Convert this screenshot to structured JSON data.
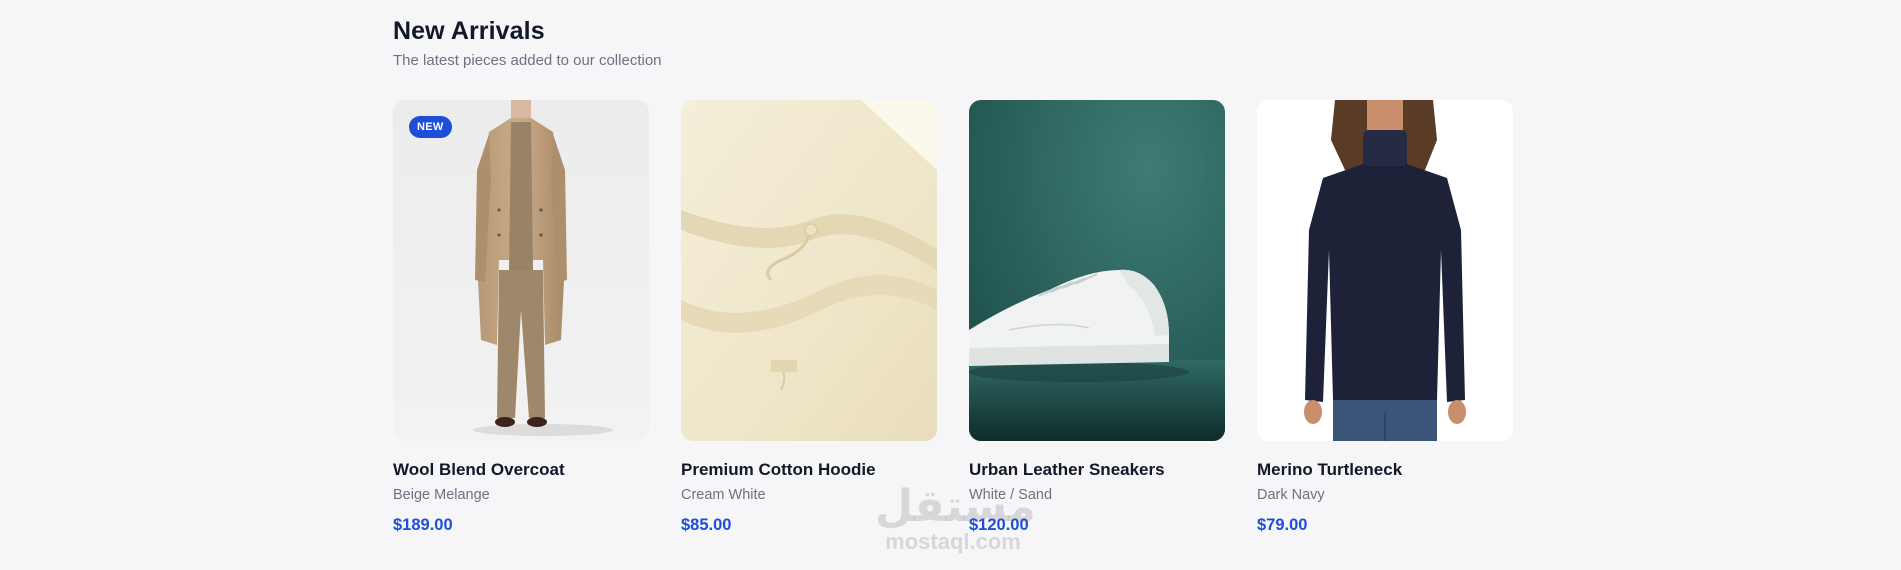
{
  "section": {
    "title": "New Arrivals",
    "subtitle": "The latest pieces added to our collection"
  },
  "products": [
    {
      "name": "Wool Blend Overcoat",
      "color": "Beige Melange",
      "price": "$189.00",
      "badge": "NEW",
      "image_icon": "overcoat-photo"
    },
    {
      "name": "Premium Cotton Hoodie",
      "color": "Cream White",
      "price": "$85.00",
      "badge": "",
      "image_icon": "hoodie-photo"
    },
    {
      "name": "Urban Leather Sneakers",
      "color": "White / Sand",
      "price": "$120.00",
      "badge": "",
      "image_icon": "sneaker-photo"
    },
    {
      "name": "Merino Turtleneck",
      "color": "Dark Navy",
      "price": "$79.00",
      "badge": "",
      "image_icon": "turtleneck-photo"
    }
  ],
  "watermark": {
    "arabic": "مستقل",
    "latin": "mostaql.com"
  },
  "colors": {
    "background": "#f6f6f8",
    "accent": "#1d4ed8",
    "text_primary": "#111827",
    "text_muted": "#6b7280"
  }
}
